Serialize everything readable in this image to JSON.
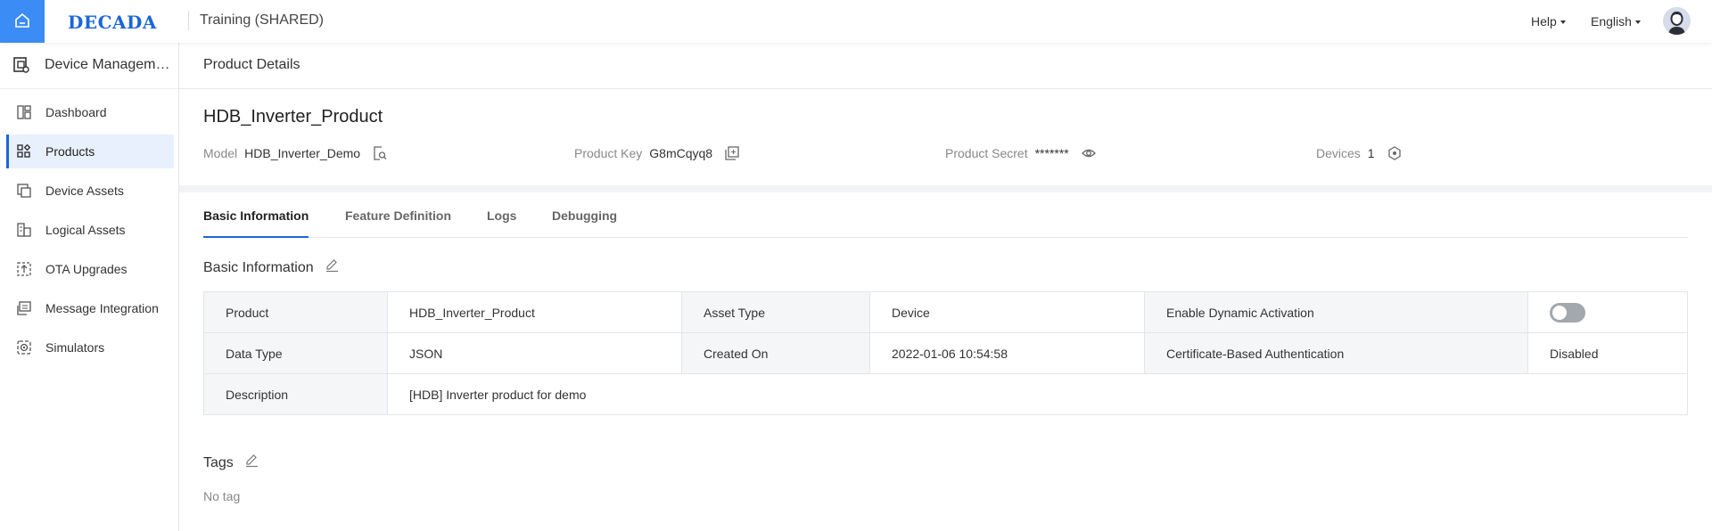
{
  "topbar": {
    "logo": "DECADA",
    "app_title": "Training (SHARED)",
    "help": "Help",
    "language": "English"
  },
  "sidebar": {
    "header": "Device Management",
    "items": [
      {
        "label": "Dashboard",
        "icon": "dashboard-icon",
        "active": false
      },
      {
        "label": "Products",
        "icon": "products-icon",
        "active": true
      },
      {
        "label": "Device Assets",
        "icon": "device-assets-icon",
        "active": false
      },
      {
        "label": "Logical Assets",
        "icon": "logical-assets-icon",
        "active": false
      },
      {
        "label": "OTA Upgrades",
        "icon": "ota-icon",
        "active": false
      },
      {
        "label": "Message Integration",
        "icon": "message-icon",
        "active": false
      },
      {
        "label": "Simulators",
        "icon": "simulator-icon",
        "active": false
      }
    ]
  },
  "page": {
    "header": "Product Details",
    "product_name": "HDB_Inverter_Product",
    "meta": {
      "model_label": "Model",
      "model_value": "HDB_Inverter_Demo",
      "key_label": "Product Key",
      "key_value": "G8mCqyq8",
      "secret_label": "Product Secret",
      "secret_value": "*******",
      "devices_label": "Devices",
      "devices_value": "1"
    },
    "tabs": [
      "Basic Information",
      "Feature Definition",
      "Logs",
      "Debugging"
    ],
    "active_tab": "Basic Information"
  },
  "basic_info": {
    "title": "Basic Information",
    "rows": [
      {
        "product_label": "Product",
        "product_value": "HDB_Inverter_Product",
        "asset_type_label": "Asset Type",
        "asset_type_value": "Device",
        "dynamic_label": "Enable Dynamic Activation",
        "dynamic_enabled": false
      },
      {
        "data_type_label": "Data Type",
        "data_type_value": "JSON",
        "created_label": "Created On",
        "created_value": "2022-01-06 10:54:58",
        "cert_label": "Certificate-Based Authentication",
        "cert_value": "Disabled"
      },
      {
        "desc_label": "Description",
        "desc_value": "[HDB] Inverter product for demo"
      }
    ]
  },
  "tags": {
    "title": "Tags",
    "empty_text": "No tag"
  },
  "colors": {
    "accent": "#1a66d9",
    "home_button": "#3b8cf5",
    "active_nav_bg": "#e8f0fd",
    "label_cell_bg": "#f5f6f8"
  }
}
